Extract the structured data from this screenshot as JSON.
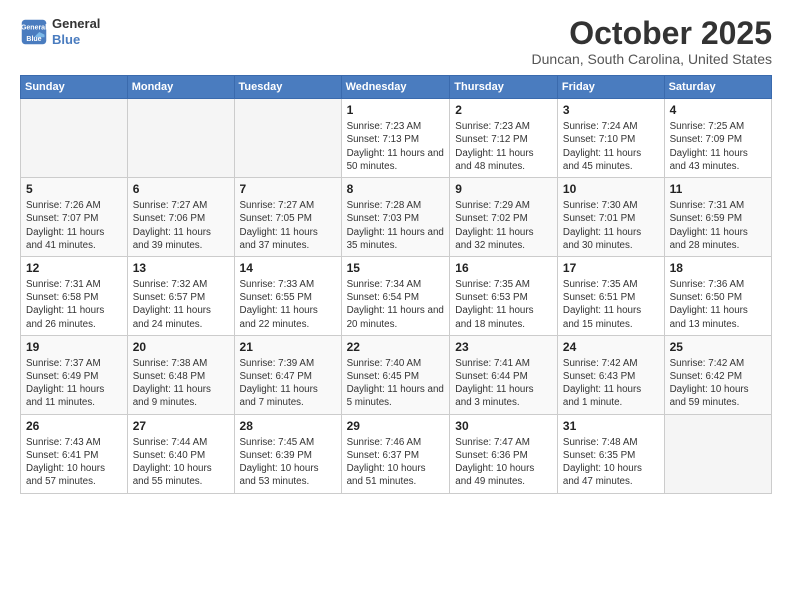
{
  "header": {
    "logo": {
      "line1": "General",
      "line2": "Blue"
    },
    "title": "October 2025",
    "location": "Duncan, South Carolina, United States"
  },
  "weekdays": [
    "Sunday",
    "Monday",
    "Tuesday",
    "Wednesday",
    "Thursday",
    "Friday",
    "Saturday"
  ],
  "weeks": [
    [
      {
        "date": "",
        "empty": true
      },
      {
        "date": "",
        "empty": true
      },
      {
        "date": "",
        "empty": true
      },
      {
        "date": "1",
        "sunrise": "7:23 AM",
        "sunset": "7:13 PM",
        "daylight": "11 hours and 50 minutes."
      },
      {
        "date": "2",
        "sunrise": "7:23 AM",
        "sunset": "7:12 PM",
        "daylight": "11 hours and 48 minutes."
      },
      {
        "date": "3",
        "sunrise": "7:24 AM",
        "sunset": "7:10 PM",
        "daylight": "11 hours and 45 minutes."
      },
      {
        "date": "4",
        "sunrise": "7:25 AM",
        "sunset": "7:09 PM",
        "daylight": "11 hours and 43 minutes."
      }
    ],
    [
      {
        "date": "5",
        "sunrise": "7:26 AM",
        "sunset": "7:07 PM",
        "daylight": "11 hours and 41 minutes."
      },
      {
        "date": "6",
        "sunrise": "7:27 AM",
        "sunset": "7:06 PM",
        "daylight": "11 hours and 39 minutes."
      },
      {
        "date": "7",
        "sunrise": "7:27 AM",
        "sunset": "7:05 PM",
        "daylight": "11 hours and 37 minutes."
      },
      {
        "date": "8",
        "sunrise": "7:28 AM",
        "sunset": "7:03 PM",
        "daylight": "11 hours and 35 minutes."
      },
      {
        "date": "9",
        "sunrise": "7:29 AM",
        "sunset": "7:02 PM",
        "daylight": "11 hours and 32 minutes."
      },
      {
        "date": "10",
        "sunrise": "7:30 AM",
        "sunset": "7:01 PM",
        "daylight": "11 hours and 30 minutes."
      },
      {
        "date": "11",
        "sunrise": "7:31 AM",
        "sunset": "6:59 PM",
        "daylight": "11 hours and 28 minutes."
      }
    ],
    [
      {
        "date": "12",
        "sunrise": "7:31 AM",
        "sunset": "6:58 PM",
        "daylight": "11 hours and 26 minutes."
      },
      {
        "date": "13",
        "sunrise": "7:32 AM",
        "sunset": "6:57 PM",
        "daylight": "11 hours and 24 minutes."
      },
      {
        "date": "14",
        "sunrise": "7:33 AM",
        "sunset": "6:55 PM",
        "daylight": "11 hours and 22 minutes."
      },
      {
        "date": "15",
        "sunrise": "7:34 AM",
        "sunset": "6:54 PM",
        "daylight": "11 hours and 20 minutes."
      },
      {
        "date": "16",
        "sunrise": "7:35 AM",
        "sunset": "6:53 PM",
        "daylight": "11 hours and 18 minutes."
      },
      {
        "date": "17",
        "sunrise": "7:35 AM",
        "sunset": "6:51 PM",
        "daylight": "11 hours and 15 minutes."
      },
      {
        "date": "18",
        "sunrise": "7:36 AM",
        "sunset": "6:50 PM",
        "daylight": "11 hours and 13 minutes."
      }
    ],
    [
      {
        "date": "19",
        "sunrise": "7:37 AM",
        "sunset": "6:49 PM",
        "daylight": "11 hours and 11 minutes."
      },
      {
        "date": "20",
        "sunrise": "7:38 AM",
        "sunset": "6:48 PM",
        "daylight": "11 hours and 9 minutes."
      },
      {
        "date": "21",
        "sunrise": "7:39 AM",
        "sunset": "6:47 PM",
        "daylight": "11 hours and 7 minutes."
      },
      {
        "date": "22",
        "sunrise": "7:40 AM",
        "sunset": "6:45 PM",
        "daylight": "11 hours and 5 minutes."
      },
      {
        "date": "23",
        "sunrise": "7:41 AM",
        "sunset": "6:44 PM",
        "daylight": "11 hours and 3 minutes."
      },
      {
        "date": "24",
        "sunrise": "7:42 AM",
        "sunset": "6:43 PM",
        "daylight": "11 hours and 1 minute."
      },
      {
        "date": "25",
        "sunrise": "7:42 AM",
        "sunset": "6:42 PM",
        "daylight": "10 hours and 59 minutes."
      }
    ],
    [
      {
        "date": "26",
        "sunrise": "7:43 AM",
        "sunset": "6:41 PM",
        "daylight": "10 hours and 57 minutes."
      },
      {
        "date": "27",
        "sunrise": "7:44 AM",
        "sunset": "6:40 PM",
        "daylight": "10 hours and 55 minutes."
      },
      {
        "date": "28",
        "sunrise": "7:45 AM",
        "sunset": "6:39 PM",
        "daylight": "10 hours and 53 minutes."
      },
      {
        "date": "29",
        "sunrise": "7:46 AM",
        "sunset": "6:37 PM",
        "daylight": "10 hours and 51 minutes."
      },
      {
        "date": "30",
        "sunrise": "7:47 AM",
        "sunset": "6:36 PM",
        "daylight": "10 hours and 49 minutes."
      },
      {
        "date": "31",
        "sunrise": "7:48 AM",
        "sunset": "6:35 PM",
        "daylight": "10 hours and 47 minutes."
      },
      {
        "date": "",
        "empty": true
      }
    ]
  ],
  "labels": {
    "sunrise": "Sunrise:",
    "sunset": "Sunset:",
    "daylight": "Daylight:"
  }
}
